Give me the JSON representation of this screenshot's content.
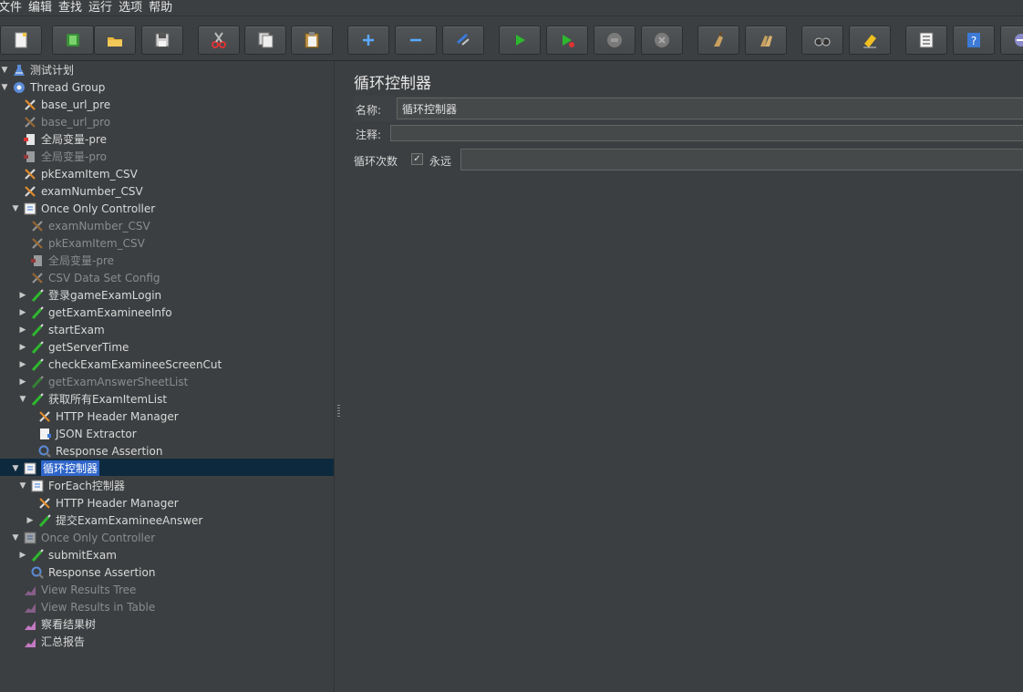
{
  "menu": [
    "文件",
    "编辑",
    "查找",
    "运行",
    "选项",
    "帮助"
  ],
  "toolbar": {
    "buttons": [
      {
        "name": "new-button",
        "icon": "new-file-icon"
      },
      {
        "name": "templates-button",
        "icon": "templates-icon"
      },
      {
        "name": "open-button",
        "icon": "open-folder-icon"
      },
      {
        "name": "save-button",
        "icon": "save-icon"
      },
      {
        "name": "cut-button",
        "icon": "scissors-icon"
      },
      {
        "name": "copy-button",
        "icon": "copy-icon"
      },
      {
        "name": "paste-button",
        "icon": "paste-icon"
      },
      {
        "name": "expand-all-button",
        "icon": "plus-icon"
      },
      {
        "name": "collapse-all-button",
        "icon": "minus-icon"
      },
      {
        "name": "toggle-button",
        "icon": "toggle-icon"
      },
      {
        "name": "start-button",
        "icon": "play-icon"
      },
      {
        "name": "start-no-pause-button",
        "icon": "play-no-pause-icon"
      },
      {
        "name": "stop-button",
        "icon": "stop-icon"
      },
      {
        "name": "shutdown-button",
        "icon": "shutdown-icon"
      },
      {
        "name": "clear-button",
        "icon": "broom-icon"
      },
      {
        "name": "clear-all-button",
        "icon": "broom-all-icon"
      },
      {
        "name": "search-button",
        "icon": "binoculars-icon"
      },
      {
        "name": "reset-search-button",
        "icon": "eraser-icon"
      },
      {
        "name": "function-helper-button",
        "icon": "list-icon"
      },
      {
        "name": "help-button",
        "icon": "question-icon"
      },
      {
        "name": "remote-button",
        "icon": "remote-icon"
      }
    ]
  },
  "tree": [
    {
      "label": "测试计划",
      "depth": 0,
      "arrow": "down",
      "icon": "flask-icon",
      "disabled": false
    },
    {
      "label": "Thread Group",
      "depth": 0,
      "arrow": "down",
      "icon": "gear-icon",
      "disabled": false
    },
    {
      "label": "base_url_pre",
      "depth": 1,
      "arrow": "",
      "icon": "config-element-icon",
      "disabled": false
    },
    {
      "label": "base_url_pro",
      "depth": 1,
      "arrow": "",
      "icon": "config-element-icon",
      "disabled": true
    },
    {
      "label": "全局变量-pre",
      "depth": 1,
      "arrow": "",
      "icon": "preprocessor-icon",
      "disabled": false
    },
    {
      "label": "全局变量-pro",
      "depth": 1,
      "arrow": "",
      "icon": "preprocessor-icon",
      "disabled": true
    },
    {
      "label": "pkExamItem_CSV",
      "depth": 1,
      "arrow": "",
      "icon": "config-element-icon",
      "disabled": false
    },
    {
      "label": "examNumber_CSV",
      "depth": 1,
      "arrow": "",
      "icon": "config-element-icon",
      "disabled": false
    },
    {
      "label": "Once Only Controller",
      "depth": 1,
      "arrow": "down",
      "icon": "controller-icon",
      "disabled": false
    },
    {
      "label": "examNumber_CSV",
      "depth": 2,
      "arrow": "",
      "icon": "config-element-icon",
      "disabled": true
    },
    {
      "label": "pkExamItem_CSV",
      "depth": 2,
      "arrow": "",
      "icon": "config-element-icon",
      "disabled": true
    },
    {
      "label": "全局变量-pre",
      "depth": 2,
      "arrow": "",
      "icon": "preprocessor-icon",
      "disabled": true
    },
    {
      "label": "CSV Data Set Config",
      "depth": 2,
      "arrow": "",
      "icon": "config-element-icon",
      "disabled": true
    },
    {
      "label": "登录gameExamLogin",
      "depth": 2,
      "arrow": "right",
      "icon": "sampler-icon",
      "disabled": false
    },
    {
      "label": "getExamExamineeInfo",
      "depth": 2,
      "arrow": "right",
      "icon": "sampler-icon",
      "disabled": false
    },
    {
      "label": "startExam",
      "depth": 2,
      "arrow": "right",
      "icon": "sampler-icon",
      "disabled": false
    },
    {
      "label": "getServerTime",
      "depth": 2,
      "arrow": "right",
      "icon": "sampler-icon",
      "disabled": false
    },
    {
      "label": "checkExamExamineeScreenCut",
      "depth": 2,
      "arrow": "right",
      "icon": "sampler-icon",
      "disabled": false
    },
    {
      "label": "getExamAnswerSheetList",
      "depth": 2,
      "arrow": "right",
      "icon": "sampler-icon",
      "disabled": true
    },
    {
      "label": "获取所有ExamItemList",
      "depth": 2,
      "arrow": "down",
      "icon": "sampler-icon",
      "disabled": false
    },
    {
      "label": "HTTP Header Manager",
      "depth": 3,
      "arrow": "",
      "icon": "config-element-icon",
      "disabled": false
    },
    {
      "label": "JSON Extractor",
      "depth": 3,
      "arrow": "",
      "icon": "postprocessor-icon",
      "disabled": false
    },
    {
      "label": "Response Assertion",
      "depth": 3,
      "arrow": "",
      "icon": "assertion-icon",
      "disabled": false
    },
    {
      "label": "循环控制器",
      "depth": 1,
      "arrow": "down",
      "icon": "controller-icon",
      "disabled": false,
      "selected": true
    },
    {
      "label": "ForEach控制器",
      "depth": 2,
      "arrow": "down",
      "icon": "controller-icon",
      "disabled": false
    },
    {
      "label": "HTTP Header Manager",
      "depth": 3,
      "arrow": "",
      "icon": "config-element-icon",
      "disabled": false
    },
    {
      "label": "提交ExamExamineeAnswer",
      "depth": 3,
      "arrow": "right",
      "icon": "sampler-icon",
      "disabled": false
    },
    {
      "label": "Once Only Controller",
      "depth": 1,
      "arrow": "down",
      "icon": "controller-icon",
      "disabled": true
    },
    {
      "label": "submitExam",
      "depth": 2,
      "arrow": "right",
      "icon": "sampler-icon",
      "disabled": false
    },
    {
      "label": "Response Assertion",
      "depth": 2,
      "arrow": "",
      "icon": "assertion-icon",
      "disabled": false
    },
    {
      "label": "View Results Tree",
      "depth": 1,
      "arrow": "",
      "icon": "listener-icon",
      "disabled": true
    },
    {
      "label": "View Results in Table",
      "depth": 1,
      "arrow": "",
      "icon": "listener-icon",
      "disabled": true
    },
    {
      "label": "察看结果树",
      "depth": 1,
      "arrow": "",
      "icon": "listener-icon",
      "disabled": false
    },
    {
      "label": "汇总报告",
      "depth": 1,
      "arrow": "",
      "icon": "listener-icon",
      "disabled": false
    }
  ],
  "panel": {
    "title": "循环控制器",
    "name_label": "名称:",
    "name_value": "循环控制器",
    "comment_label": "注释:",
    "comment_value": "",
    "loop_label": "循环次数",
    "forever_label": "永远",
    "forever_checked": true,
    "loop_value": ""
  }
}
